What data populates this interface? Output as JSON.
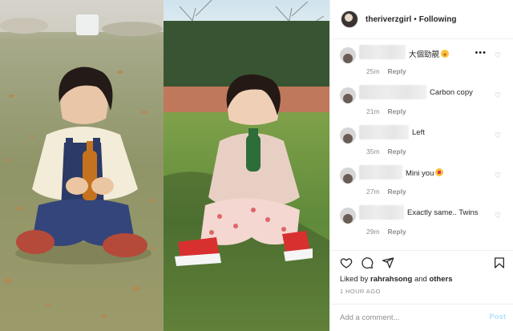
{
  "post": {
    "username": "theriverzgirl",
    "separator": "•",
    "follow_status": "Following"
  },
  "comments": [
    {
      "text": "大個勁靚",
      "emoji": "grinning-face-emoji",
      "time": "25m",
      "reply": "Reply",
      "has_more": true,
      "more_label": "•••"
    },
    {
      "text": "Carbon copy",
      "time": "21m",
      "reply": "Reply"
    },
    {
      "text": "Left",
      "time": "35m",
      "reply": "Reply"
    },
    {
      "text": "Mini you",
      "emoji": "heart-eyes-emoji",
      "time": "27m",
      "reply": "Reply"
    },
    {
      "text": "Exactly same.. Twins",
      "time": "29m",
      "reply": "Reply"
    }
  ],
  "actions": {
    "liked_prefix": "Liked by",
    "liked_user": "rahrahsong",
    "liked_and": "and",
    "liked_others": "others",
    "time_ago": "1 HOUR AGO"
  },
  "add_comment": {
    "placeholder": "Add a comment...",
    "post_label": "Post"
  },
  "colors": {
    "post_button_disabled": "#b2dffc",
    "muted_text": "#8e8e8e",
    "border": "#efefef"
  }
}
